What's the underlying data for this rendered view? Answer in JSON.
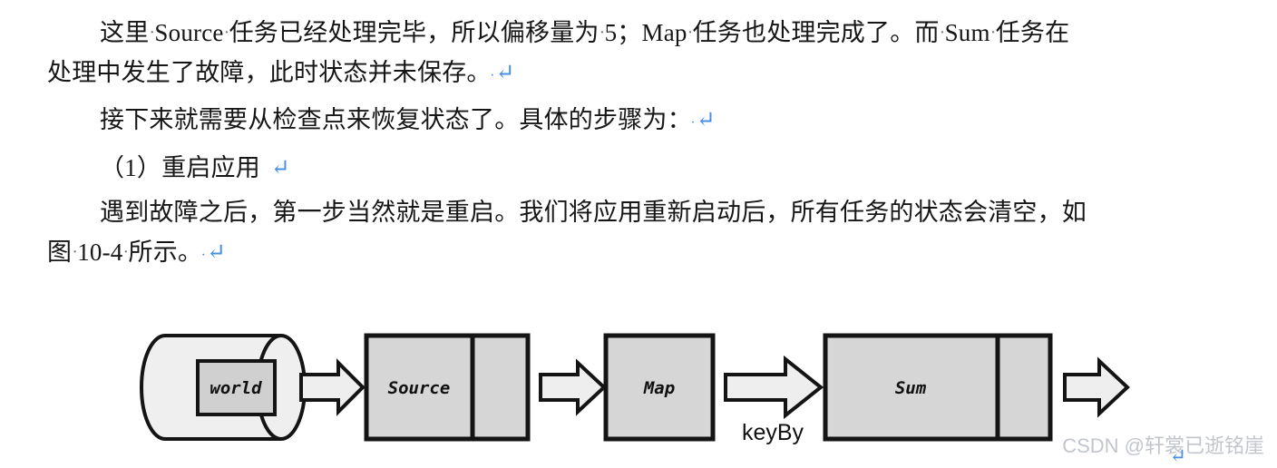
{
  "document": {
    "paragraphs": [
      {
        "id": "p1-line1",
        "indent": true,
        "segments": [
          {
            "type": "cjk",
            "text": "这里"
          },
          {
            "type": "sep"
          },
          {
            "type": "latin",
            "text": "Source"
          },
          {
            "type": "sep"
          },
          {
            "type": "cjk",
            "text": "任务已经处理完毕，所以偏移量为"
          },
          {
            "type": "sep"
          },
          {
            "type": "latin",
            "text": "5"
          },
          {
            "type": "cjk",
            "text": "；"
          },
          {
            "type": "latin",
            "text": "Map"
          },
          {
            "type": "sep"
          },
          {
            "type": "cjk",
            "text": "任务也处理完成了。而"
          },
          {
            "type": "sep"
          },
          {
            "type": "latin",
            "text": "Sum"
          },
          {
            "type": "sep"
          },
          {
            "type": "cjk",
            "text": "任务在"
          }
        ],
        "pilcrow": false
      },
      {
        "id": "p1-line2",
        "indent": false,
        "segments": [
          {
            "type": "cjk",
            "text": "处理中发生了故障，此时状态并未保存。"
          }
        ],
        "pilcrow": true
      },
      {
        "id": "p2",
        "indent": true,
        "segments": [
          {
            "type": "cjk",
            "text": "接下来就需要从检查点来恢复状态了。具体的步骤为："
          }
        ],
        "pilcrow": true
      },
      {
        "id": "p3",
        "indent": true,
        "segments": [
          {
            "type": "cjk",
            "text": "（1）重启应用"
          }
        ],
        "pilcrow": true
      },
      {
        "id": "p4-line1",
        "indent": true,
        "segments": [
          {
            "type": "cjk",
            "text": "遇到故障之后，第一步当然就是重启。我们将应用重新启动后，所有任务的状态会清空，如"
          }
        ],
        "pilcrow": false
      },
      {
        "id": "p4-line2",
        "indent": false,
        "segments": [
          {
            "type": "cjk",
            "text": "图"
          },
          {
            "type": "sep"
          },
          {
            "type": "latin",
            "text": "10-4"
          },
          {
            "type": "sep"
          },
          {
            "type": "cjk",
            "text": "所示。"
          }
        ],
        "pilcrow": true
      }
    ],
    "pilcrow_glyph": "↵",
    "separator_glyph": "·"
  },
  "figure": {
    "caption_reference": "图 10-4",
    "colors": {
      "node_fill": "#d6d6d6",
      "cylinder_fill": "#efefef",
      "store_fill": "#d0d0d0",
      "arrow_fill": "#eeeeee",
      "stroke": "#141414"
    },
    "source_store": {
      "name": "source-datastore",
      "label": "world"
    },
    "nodes": [
      {
        "name": "source-node",
        "label": "Source",
        "has_state_slot": true,
        "state_value": ""
      },
      {
        "name": "map-node",
        "label": "Map",
        "has_state_slot": false,
        "state_value": ""
      },
      {
        "name": "sum-node",
        "label": "Sum",
        "has_state_slot": true,
        "state_value": ""
      }
    ],
    "edges": [
      {
        "name": "edge-source-in",
        "label": ""
      },
      {
        "name": "edge-source-to-map",
        "label": ""
      },
      {
        "name": "edge-map-to-sum",
        "label": "keyBy"
      },
      {
        "name": "edge-sum-out",
        "label": ""
      }
    ]
  },
  "watermark": {
    "text": "CSDN @轩裳已逝铭崖",
    "pilcrow": "↵"
  }
}
